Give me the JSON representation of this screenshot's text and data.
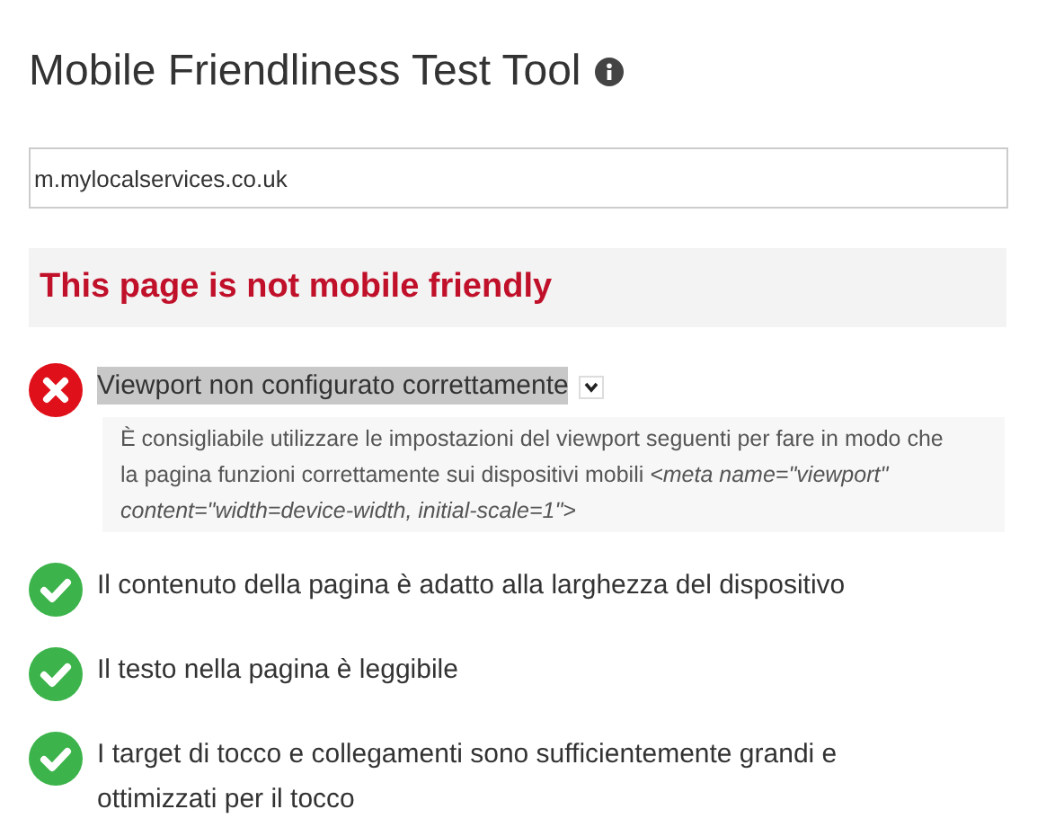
{
  "title": "Mobile Friendliness Test Tool",
  "url_field": {
    "value": "m.mylocalservices.co.uk"
  },
  "verdict": "This page is not mobile friendly",
  "checks": [
    {
      "kind": "fail",
      "label": "Viewport non configurato correttamente",
      "selected": true,
      "expanded": true,
      "detail": "È consigliabile utilizzare le impostazioni del viewport seguenti per fare in modo che la pagina funzioni correttamente sui dispositivi mobili *<meta name=\"viewport\" content=\"width=device-width, initial-scale=1\">*"
    },
    {
      "kind": "pass",
      "label": "Il contenuto della pagina è adatto alla larghezza del dispositivo",
      "selected": false
    },
    {
      "kind": "pass",
      "label": "Il testo nella pagina è leggibile",
      "selected": false
    },
    {
      "kind": "pass",
      "label": "I target di tocco e collegamenti sono sufficientemente grandi e ottimizzati per il tocco",
      "selected": false
    }
  ]
}
